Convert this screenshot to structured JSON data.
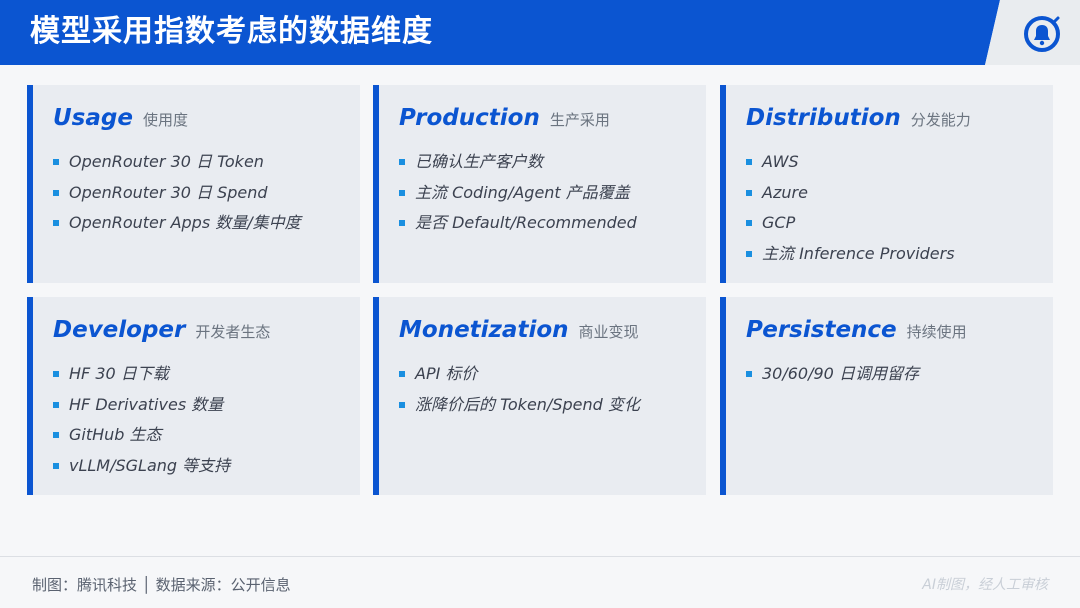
{
  "header": {
    "title": "模型采用指数考虑的数据维度",
    "logo_icon": "tencent-bell-logo"
  },
  "colors": {
    "accent": "#0b55d1",
    "bullet": "#1a8fe0",
    "card_bg": "#e9ecf1"
  },
  "cards": [
    {
      "title_en": "Usage",
      "title_cn": "使用度",
      "items": [
        "OpenRouter 30 日 Token",
        "OpenRouter 30 日 Spend",
        "OpenRouter Apps 数量/集中度"
      ]
    },
    {
      "title_en": "Production",
      "title_cn": "生产采用",
      "items": [
        "已确认生产客户数",
        "主流 Coding/Agent 产品覆盖",
        "是否 Default/Recommended"
      ]
    },
    {
      "title_en": "Distribution",
      "title_cn": "分发能力",
      "items": [
        "AWS",
        "Azure",
        "GCP",
        "主流 Inference Providers"
      ]
    },
    {
      "title_en": "Developer",
      "title_cn": "开发者生态",
      "items": [
        "HF 30 日下载",
        "HF Derivatives 数量",
        "GitHub 生态",
        "vLLM/SGLang 等支持"
      ]
    },
    {
      "title_en": "Monetization",
      "title_cn": "商业变现",
      "items": [
        "API 标价",
        "涨降价后的 Token/Spend 变化"
      ]
    },
    {
      "title_en": "Persistence",
      "title_cn": "持续使用",
      "items": [
        "30/60/90 日调用留存"
      ]
    }
  ],
  "footer": {
    "credits": "制图：腾讯科技 │ 数据来源：公开信息",
    "watermark": "AI制图，经人工审核"
  }
}
